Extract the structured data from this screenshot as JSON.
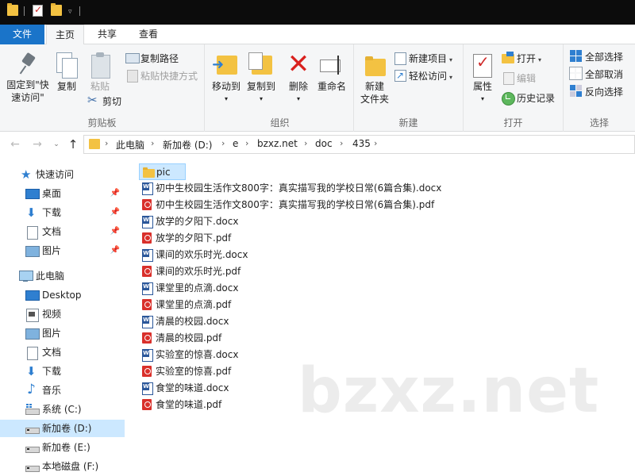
{
  "tabs": {
    "file": "文件",
    "home": "主页",
    "share": "共享",
    "view": "查看"
  },
  "ribbon": {
    "clipboard": {
      "label": "剪贴板",
      "pin_quick_access": "固定到\"快速访问\"",
      "copy": "复制",
      "paste": "粘贴",
      "copy_path": "复制路径",
      "paste_shortcut": "粘贴快捷方式",
      "cut": "剪切"
    },
    "organize": {
      "label": "组织",
      "move_to": "移动到",
      "copy_to": "复制到",
      "delete": "删除",
      "rename": "重命名"
    },
    "new": {
      "label": "新建",
      "new_folder": "新建\n文件夹",
      "new_item": "新建项目",
      "easy_access": "轻松访问"
    },
    "open": {
      "label": "打开",
      "properties": "属性",
      "open": "打开",
      "edit": "编辑",
      "history": "历史记录"
    },
    "select": {
      "label": "选择",
      "select_all": "全部选择",
      "select_none": "全部取消",
      "invert": "反向选择"
    }
  },
  "breadcrumb": [
    "此电脑",
    "新加卷 (D:)",
    "e",
    "bzxz.net",
    "doc",
    "435"
  ],
  "sidebar": {
    "quick_access": "快速访问",
    "quick_items": [
      "桌面",
      "下载",
      "文档",
      "图片"
    ],
    "this_pc": "此电脑",
    "pc_items": [
      "Desktop",
      "视频",
      "图片",
      "文档",
      "下载",
      "音乐"
    ],
    "drives": [
      "系统 (C:)",
      "新加卷 (D:)",
      "新加卷 (E:)",
      "本地磁盘 (F:)"
    ]
  },
  "files": [
    {
      "name": "pic",
      "type": "folder"
    },
    {
      "name": "初中生校园生活作文800字：真实描写我的学校日常(6篇合集).docx",
      "type": "docx"
    },
    {
      "name": "初中生校园生活作文800字：真实描写我的学校日常(6篇合集).pdf",
      "type": "pdf"
    },
    {
      "name": "放学的夕阳下.docx",
      "type": "docx"
    },
    {
      "name": "放学的夕阳下.pdf",
      "type": "pdf"
    },
    {
      "name": "课间的欢乐时光.docx",
      "type": "docx"
    },
    {
      "name": "课间的欢乐时光.pdf",
      "type": "pdf"
    },
    {
      "name": "课堂里的点滴.docx",
      "type": "docx"
    },
    {
      "name": "课堂里的点滴.pdf",
      "type": "pdf"
    },
    {
      "name": "清晨的校园.docx",
      "type": "docx"
    },
    {
      "name": "清晨的校园.pdf",
      "type": "pdf"
    },
    {
      "name": "实验室的惊喜.docx",
      "type": "docx"
    },
    {
      "name": "实验室的惊喜.pdf",
      "type": "pdf"
    },
    {
      "name": "食堂的味道.docx",
      "type": "docx"
    },
    {
      "name": "食堂的味道.pdf",
      "type": "pdf"
    }
  ],
  "watermark": "bzxz.net",
  "colors": {
    "accent": "#1a74c9",
    "selection": "#cce8ff",
    "folder": "#f3c242",
    "pdf": "#d9302b",
    "word": "#2b579a"
  }
}
